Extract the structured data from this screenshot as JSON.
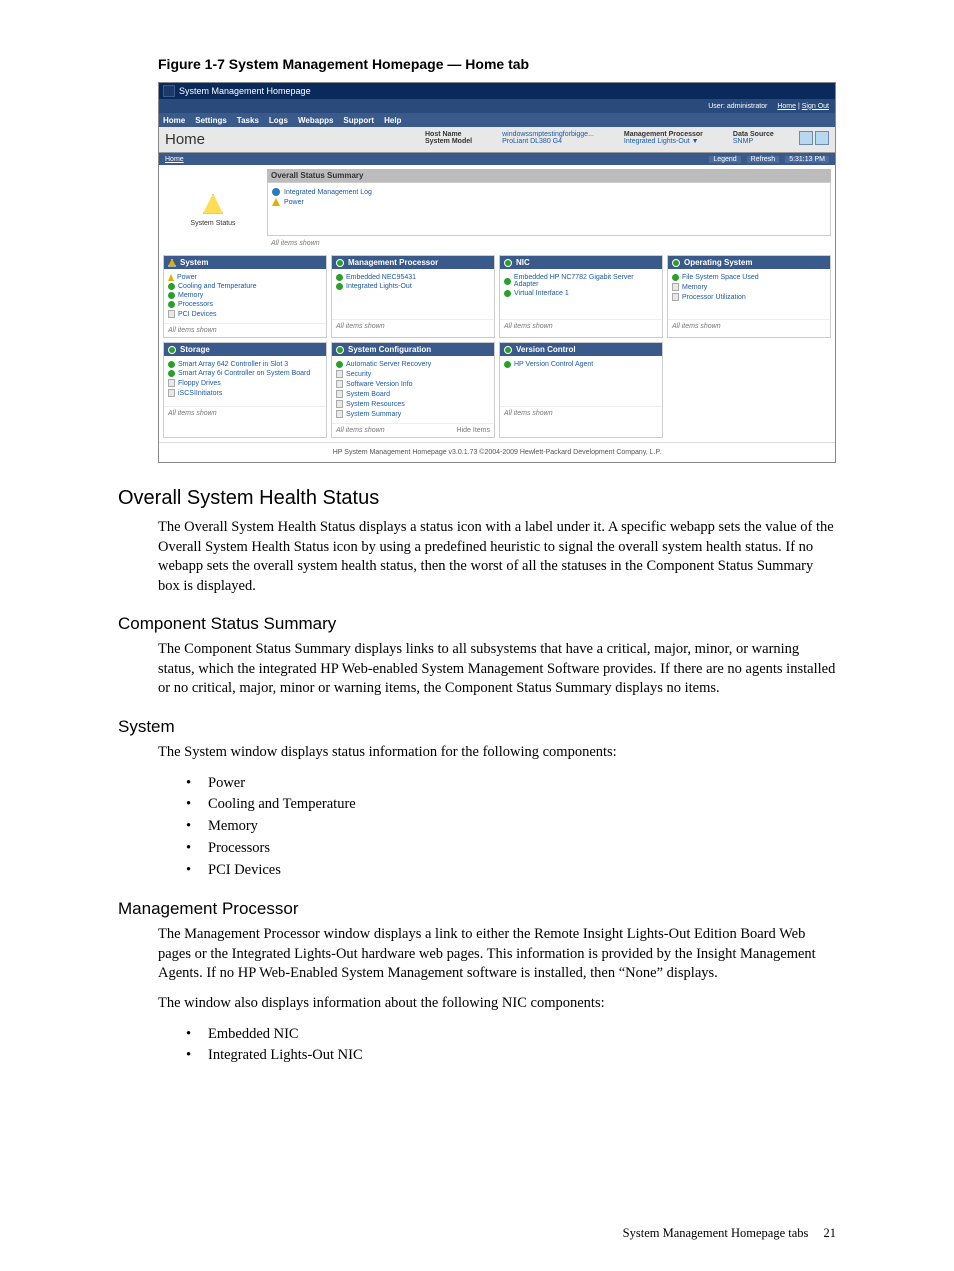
{
  "figure_caption": "Figure 1-7 System Management Homepage — Home tab",
  "screenshot": {
    "window_title": "System Management Homepage",
    "user_label": "User: administrator",
    "user_links": [
      "Home",
      "Sign Out"
    ],
    "menubar": [
      "Home",
      "Settings",
      "Tasks",
      "Logs",
      "Webapps",
      "Support",
      "Help"
    ],
    "page_title": "Home",
    "header_info": [
      {
        "label": "Host Name",
        "value": "windowssmptestingforbigge..."
      },
      {
        "label": "System Model",
        "value": "ProLiant DL380 G4"
      },
      {
        "label": "Management Processor",
        "value": "Integrated Lights-Out ▼"
      },
      {
        "label": "Data Source",
        "value": "SNMP"
      }
    ],
    "breadcrumb": "Home",
    "subbar_right": [
      "Legend",
      "Refresh",
      "5:31:13 PM"
    ],
    "status_label": "System Status",
    "summary": {
      "title": "Overall Status Summary",
      "items": [
        {
          "icon": "info",
          "text": "Integrated Management Log"
        },
        {
          "icon": "warn",
          "text": "Power"
        }
      ],
      "all_shown": "All items shown"
    },
    "cards": [
      {
        "title": "System",
        "head_icon": "warn",
        "items": [
          {
            "icon": "wn",
            "text": "Power"
          },
          {
            "icon": "ok",
            "text": "Cooling and Temperature"
          },
          {
            "icon": "ok",
            "text": "Memory"
          },
          {
            "icon": "ok",
            "text": "Processors"
          },
          {
            "icon": "dc",
            "text": "PCI Devices"
          }
        ],
        "foot": "All items shown"
      },
      {
        "title": "Management Processor",
        "head_icon": "ok",
        "items": [
          {
            "icon": "ok",
            "text": "Embedded NEC95431"
          },
          {
            "icon": "ok",
            "text": "Integrated Lights-Out"
          }
        ],
        "foot": "All items shown"
      },
      {
        "title": "NIC",
        "head_icon": "ok",
        "items": [
          {
            "icon": "ok",
            "text": "Embedded HP NC7782 Gigabit Server Adapter"
          },
          {
            "icon": "ok",
            "text": "Virtual Interface 1"
          }
        ],
        "foot": "All items shown"
      },
      {
        "title": "Operating System",
        "head_icon": "ok",
        "items": [
          {
            "icon": "ok",
            "text": "File System Space Used"
          },
          {
            "icon": "dc",
            "text": "Memory"
          },
          {
            "icon": "dc",
            "text": "Processor Utilization"
          }
        ],
        "foot": "All items shown"
      },
      {
        "title": "Storage",
        "head_icon": "ok",
        "items": [
          {
            "icon": "ok",
            "text": "Smart Array 642 Controller in Slot 3"
          },
          {
            "icon": "ok",
            "text": "Smart Array 6i Controller on System Board"
          },
          {
            "icon": "dc",
            "text": "Floppy Drives"
          },
          {
            "icon": "dc",
            "text": "iSCSIInitiators"
          }
        ],
        "foot": "All items shown"
      },
      {
        "title": "System Configuration",
        "head_icon": "ok",
        "items": [
          {
            "icon": "ok",
            "text": "Automatic Server Recovery"
          },
          {
            "icon": "dc",
            "text": "Security"
          },
          {
            "icon": "dc",
            "text": "Software Version Info"
          },
          {
            "icon": "dc",
            "text": "System Board"
          },
          {
            "icon": "dc",
            "text": "System Resources"
          },
          {
            "icon": "dc",
            "text": "System Summary"
          }
        ],
        "foot": "All items shown",
        "hide": "Hide Items"
      },
      {
        "title": "Version Control",
        "head_icon": "ok",
        "items": [
          {
            "icon": "ok",
            "text": "HP Version Control Agent"
          }
        ],
        "foot": "All items shown"
      }
    ],
    "footer": "HP System Management Homepage v3.0.1.73    ©2004-2009 Hewlett-Packard Development Company, L.P."
  },
  "sections": {
    "h_overall": "Overall System Health Status",
    "p_overall": "The Overall System Health Status displays a status icon with a label under it. A specific webapp sets the value of the Overall System Health Status icon by using a predefined heuristic to signal the overall system health status. If no webapp sets the overall system health status, then the worst of all the statuses in the Component Status Summary box is displayed.",
    "h_component": "Component Status Summary",
    "p_component": "The Component Status Summary displays links to all subsystems that have a critical, major, minor, or warning status, which the integrated HP Web-enabled System Management Software provides. If there are no agents installed or no critical, major, minor or warning items, the Component Status Summary displays no items.",
    "h_system": "System",
    "p_system": "The System window displays status information for the following components:",
    "system_items": [
      "Power",
      "Cooling and Temperature",
      "Memory",
      "Processors",
      "PCI Devices"
    ],
    "h_mp": "Management Processor",
    "p_mp1": "The Management Processor window displays a link to either the Remote Insight Lights-Out Edition Board Web pages or the Integrated Lights-Out hardware web pages. This information is provided by the Insight Management Agents. If no HP Web-Enabled System Management software is installed, then “None” displays.",
    "p_mp2": "The window also displays information about the following NIC components:",
    "mp_items": [
      "Embedded NIC",
      "Integrated Lights-Out NIC"
    ]
  },
  "page_footer": {
    "text": "System Management Homepage tabs",
    "num": "21"
  }
}
